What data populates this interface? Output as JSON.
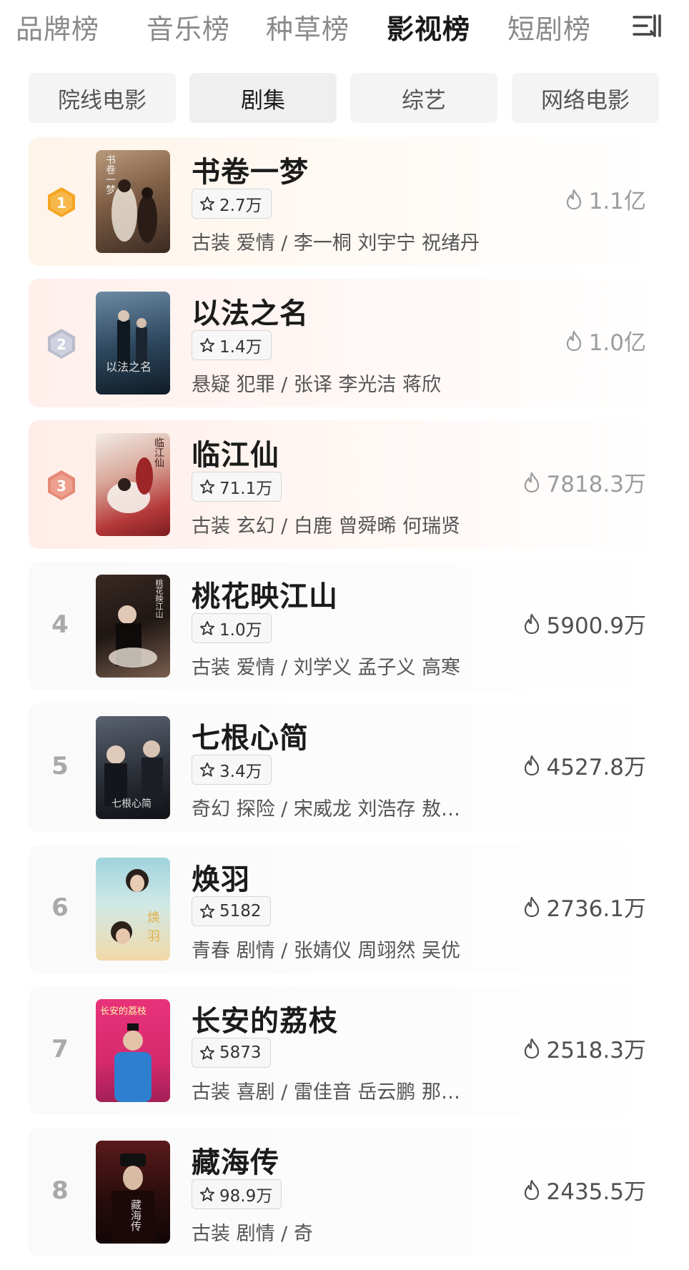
{
  "top_tabs": [
    {
      "label": "品牌榜"
    },
    {
      "label": "音乐榜"
    },
    {
      "label": "种草榜"
    },
    {
      "label": "影视榜",
      "active": true
    },
    {
      "label": "短剧榜"
    }
  ],
  "sub_tabs": [
    {
      "label": "院线电影"
    },
    {
      "label": "剧集",
      "active": true
    },
    {
      "label": "综艺"
    },
    {
      "label": "网络电影"
    }
  ],
  "items": [
    {
      "rank": "1",
      "title": "书卷一梦",
      "score": "2.7万",
      "tags": "古装 爱情 / 李一桐 刘宇宁 祝绪丹",
      "heat": "1.1亿",
      "poster_text": "书卷一梦"
    },
    {
      "rank": "2",
      "title": "以法之名",
      "score": "1.4万",
      "tags": "悬疑 犯罪 / 张译 李光洁 蒋欣",
      "heat": "1.0亿",
      "poster_text": "以法之名"
    },
    {
      "rank": "3",
      "title": "临江仙",
      "score": "71.1万",
      "tags": "古装 玄幻 / 白鹿 曾舜晞 何瑞贤",
      "heat": "7818.3万",
      "poster_text": "临江仙"
    },
    {
      "rank": "4",
      "title": "桃花映江山",
      "score": "1.0万",
      "tags": "古装 爱情 / 刘学义 孟子义 高寒",
      "heat": "5900.9万",
      "poster_text": "桃花映江山"
    },
    {
      "rank": "5",
      "title": "七根心简",
      "score": "3.4万",
      "tags": "奇幻 探险 / 宋威龙 刘浩存 敖…",
      "heat": "4527.8万",
      "poster_text": "七根心简"
    },
    {
      "rank": "6",
      "title": "焕羽",
      "score": "5182",
      "tags": "青春 剧情 / 张婧仪 周翊然 吴优",
      "heat": "2736.1万",
      "poster_text": "焕羽"
    },
    {
      "rank": "7",
      "title": "长安的荔枝",
      "score": "5873",
      "tags": "古装 喜剧 / 雷佳音 岳云鹏 那…",
      "heat": "2518.3万",
      "poster_text": "长安的荔枝"
    },
    {
      "rank": "8",
      "title": "藏海传",
      "score": "98.9万",
      "tags": "古装 剧情 /                    奇",
      "heat": "2435.5万",
      "poster_text": "藏海传"
    }
  ]
}
